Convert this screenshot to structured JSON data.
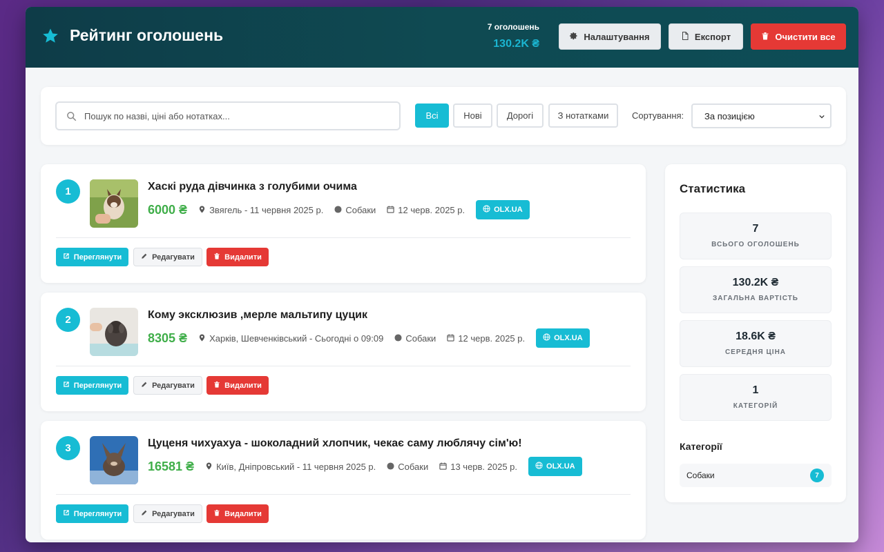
{
  "header": {
    "title": "Рейтинг оголошень",
    "count_text": "7 оголошень",
    "total_value": "130.2K ₴",
    "buttons": {
      "settings": "Налаштування",
      "export": "Експорт",
      "clear": "Очистити все"
    }
  },
  "filters": {
    "search_placeholder": "Пошук по назві, ціні або нотатках...",
    "chips": [
      "Всі",
      "Нові",
      "Дорогі",
      "З нотатками"
    ],
    "active_chip": "Всі",
    "sort_label": "Сортування:",
    "sort_value": "За позицією"
  },
  "actions": {
    "view": "Переглянути",
    "edit": "Редагувати",
    "delete": "Видалити"
  },
  "items": [
    {
      "rank": "1",
      "title": "Хаскі руда дівчинка з голубими очима",
      "price": "6000 ₴",
      "location": "Звягель - 11 червня 2025 р.",
      "category": "Собаки",
      "date": "12 черв. 2025 р.",
      "source": "OLX.UA"
    },
    {
      "rank": "2",
      "title": "Кому эксклюзив ,мерле мальтипу цуцик",
      "price": "8305 ₴",
      "location": "Харків, Шевченківський - Сьогодні о 09:09",
      "category": "Собаки",
      "date": "12 черв. 2025 р.",
      "source": "OLX.UA"
    },
    {
      "rank": "3",
      "title": "Цуценя чихуахуа - шоколадний хлопчик, чекає саму люблячу сім'ю!",
      "price": "16581 ₴",
      "location": "Київ, Дніпровський - 11 червня 2025 р.",
      "category": "Собаки",
      "date": "13 черв. 2025 р.",
      "source": "OLX.UA"
    }
  ],
  "stats": {
    "title": "Статистика",
    "boxes": [
      {
        "value": "7",
        "label": "ВСЬОГО ОГОЛОШЕНЬ"
      },
      {
        "value": "130.2K ₴",
        "label": "ЗАГАЛЬНА ВАРТІСТЬ"
      },
      {
        "value": "18.6K ₴",
        "label": "СЕРЕДНЯ ЦІНА"
      },
      {
        "value": "1",
        "label": "КАТЕГОРІЙ"
      }
    ],
    "categories_title": "Категорії",
    "categories": [
      {
        "name": "Собаки",
        "count": "7"
      }
    ]
  },
  "colors": {
    "accent": "#17bcd4",
    "danger": "#e53935",
    "price": "#3fae49",
    "header_bg": "#0f4a52"
  },
  "icons": {
    "title": "star-icon",
    "settings": "gear-icon",
    "export": "file-icon",
    "clear": "trash-icon",
    "search": "search-icon",
    "location": "map-pin-icon",
    "category": "dot-icon",
    "date": "calendar-icon",
    "source": "globe-icon",
    "view": "external-link-icon",
    "edit": "pencil-icon",
    "delete": "trash-icon",
    "sort": "chevron-down-icon"
  }
}
